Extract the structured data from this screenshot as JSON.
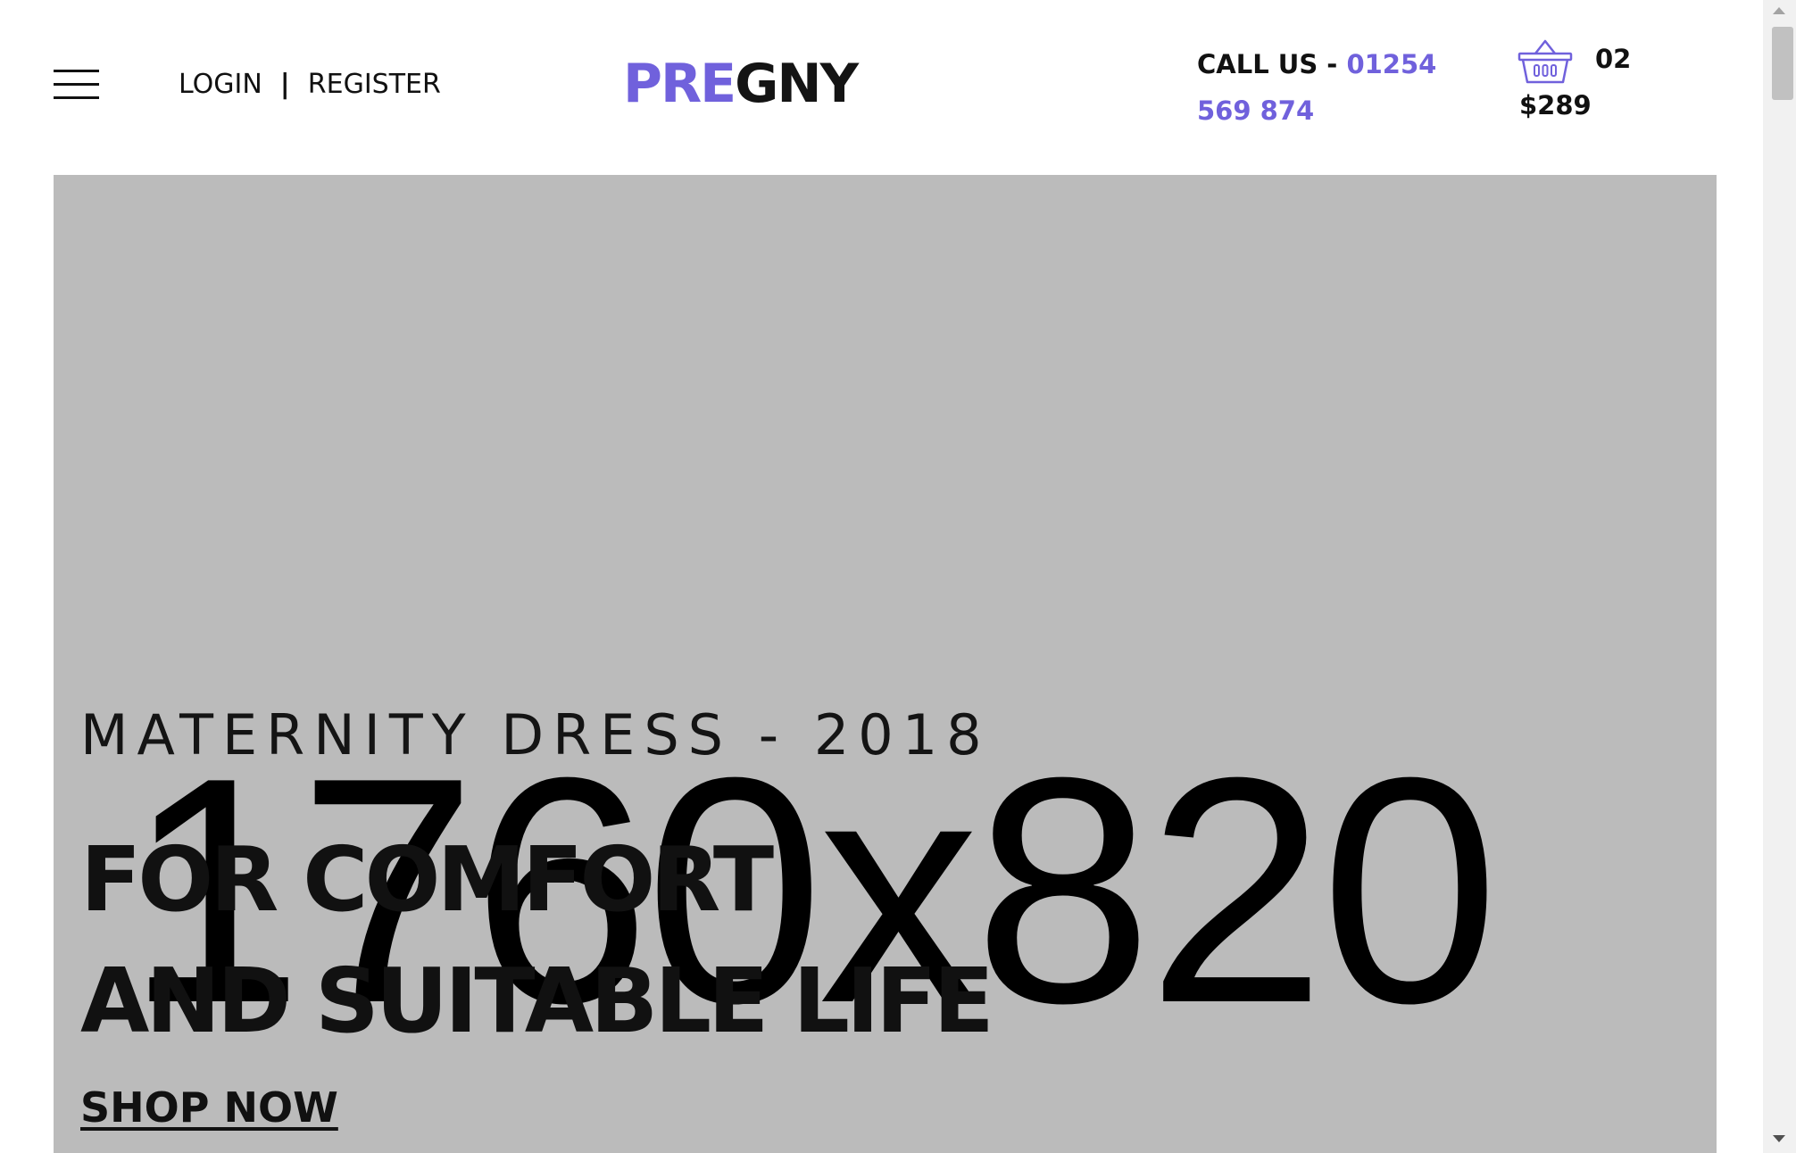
{
  "header": {
    "menu_icon": "hamburger-menu-icon",
    "login_label": "LOGIN",
    "separator": "|",
    "register_label": "REGISTER",
    "logo": {
      "part1": "PRE",
      "part2": "GNY"
    },
    "call_us": {
      "label": "CALL US - ",
      "phone": "01254 569 874"
    },
    "cart": {
      "icon": "shopping-basket-icon",
      "count": "02",
      "total": "$289"
    }
  },
  "hero": {
    "placeholder_text": "1760x820",
    "subtitle": "MATERNITY DRESS - 2018",
    "title_line1": "FOR COMFORT",
    "title_line2": "AND SUITABLE LIFE",
    "cta_label": "SHOP NOW"
  },
  "colors": {
    "accent": "#7061dc",
    "text": "#111111",
    "hero_background": "#bbbbbb"
  }
}
